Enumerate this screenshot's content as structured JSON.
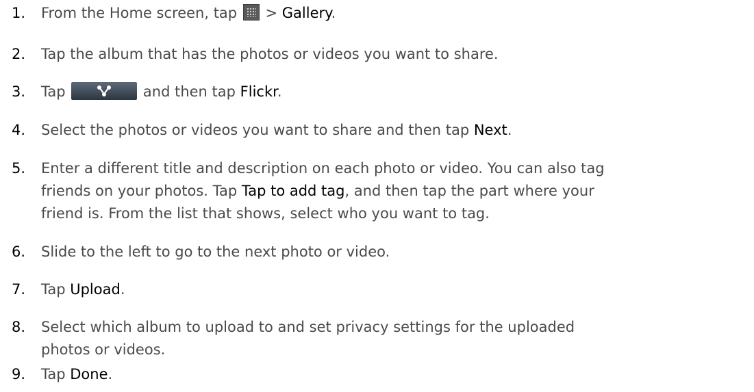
{
  "steps": [
    {
      "num": "1.",
      "parts": {
        "a": "From the Home screen, tap ",
        "b": " > ",
        "c": "Gallery",
        "d": "."
      }
    },
    {
      "num": "2.",
      "text": "Tap the album that has the photos or videos you want to share."
    },
    {
      "num": "3.",
      "parts": {
        "a": "Tap ",
        "b": " and then tap ",
        "c": "Flickr",
        "d": "."
      }
    },
    {
      "num": "4.",
      "parts": {
        "a": "Select the photos or videos you want to share and then tap ",
        "b": "Next",
        "c": "."
      }
    },
    {
      "num": "5.",
      "parts": {
        "line1": "Enter a different title and description on each photo or video. You can also tag",
        "line2a": "friends on your photos. Tap ",
        "line2b": "Tap to add tag",
        "line2c": ", and then tap the part where your",
        "line3": "friend is. From the list that shows, select who you want to tag."
      }
    },
    {
      "num": "6.",
      "text": "Slide to the left to go to the next photo or video."
    },
    {
      "num": "7.",
      "parts": {
        "a": "Tap ",
        "b": "Upload",
        "c": "."
      }
    },
    {
      "num": "8.",
      "parts": {
        "line1": "Select which album to upload to and set privacy settings for the uploaded",
        "line2": "photos or videos."
      }
    },
    {
      "num": "9.",
      "parts": {
        "a": "Tap ",
        "b": "Done",
        "c": "."
      }
    }
  ],
  "icons": {
    "all_apps": "all-apps-grid-icon",
    "share": "share-icon"
  }
}
